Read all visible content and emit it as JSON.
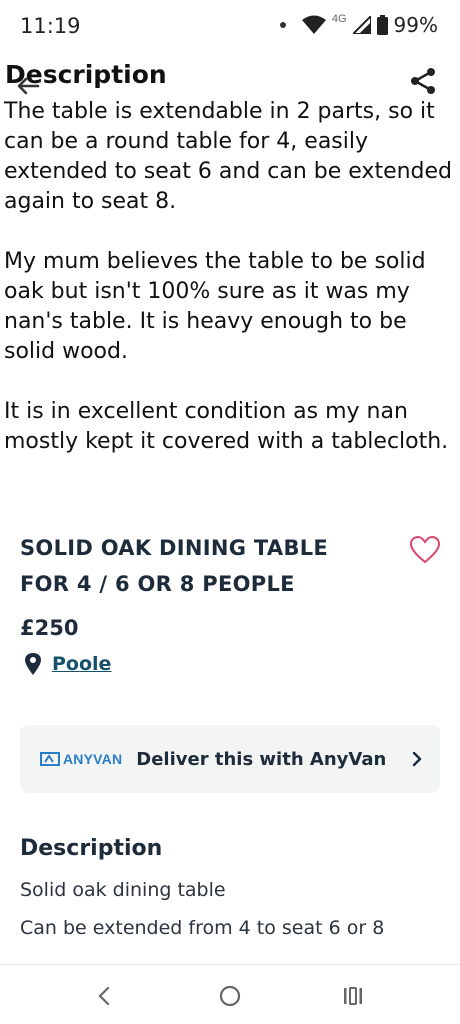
{
  "status_bar": {
    "time": "11:19",
    "network": "4G",
    "battery": "99%"
  },
  "overlay": {
    "title": "Description",
    "paragraphs": [
      "The table is extendable in 2 parts, so it can be a round table for 4, easily extended to seat 6 and can be extended again to seat 8.",
      "My mum believes the table to be solid oak but isn't 100% sure as it was my nan's table. It is heavy enough to be solid wood.",
      "It is in excellent condition as my nan mostly kept it covered with a tablecloth."
    ]
  },
  "listing": {
    "title": "SOLID OAK DINING TABLE FOR 4 / 6 OR 8 PEOPLE",
    "price": "£250",
    "location": "Poole"
  },
  "delivery": {
    "brand": "ANYVAN",
    "label": "Deliver this with AnyVan"
  },
  "description": {
    "heading": "Description",
    "lines": [
      "Solid oak dining table",
      "Can be extended from 4 to seat 6 or 8"
    ]
  },
  "colors": {
    "heading": "#1d2b3a",
    "link": "#17506b",
    "accent_heart": "#d9486b",
    "brand_anyvan": "#2a7ec6",
    "card_bg": "#f3f4f4"
  },
  "icons": [
    "back-arrow-icon",
    "share-icon",
    "heart-icon",
    "location-pin-icon",
    "chevron-right-icon",
    "wifi-icon",
    "signal-icon",
    "battery-icon"
  ]
}
